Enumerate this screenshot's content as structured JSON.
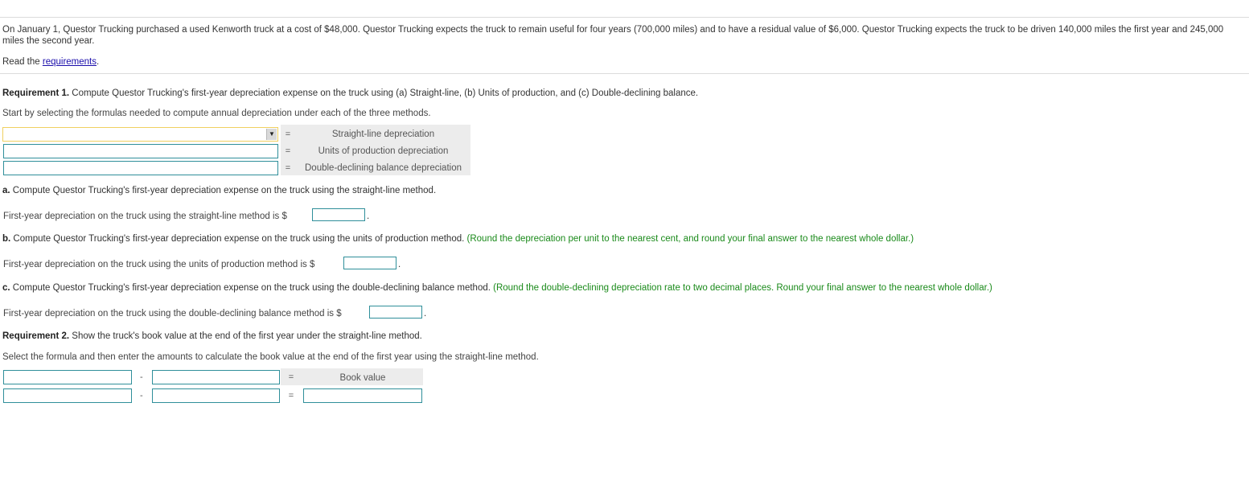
{
  "intro": {
    "text": "On January 1, Questor Trucking purchased a used Kenworth truck at a cost of $48,000. Questor Trucking expects the truck to remain useful for four years (700,000 miles) and to have a residual value of $6,000. Questor Trucking expects the truck to be driven 140,000 miles the first year and 245,000 miles the second year.",
    "read_prefix": "Read the ",
    "read_link": "requirements",
    "read_suffix": "."
  },
  "req1": {
    "bold": "Requirement 1.",
    "text": " Compute Questor Trucking's first-year depreciation expense on the truck using (a) Straight-line, (b) Units of production, and (c) Double-declining balance.",
    "instruction": "Start by selecting the formulas needed to compute annual depreciation under each of the three methods.",
    "formulas": [
      {
        "equals": "=",
        "label": "Straight-line depreciation"
      },
      {
        "equals": "=",
        "label": "Units of production depreciation"
      },
      {
        "equals": "=",
        "label": "Double-declining balance depreciation"
      }
    ]
  },
  "part_a": {
    "bold": "a.",
    "text": " Compute Questor Trucking's first-year depreciation expense on the truck using the straight-line method.",
    "answer_label": "First-year depreciation on the truck using the straight-line method is $",
    "period": "."
  },
  "part_b": {
    "bold": "b.",
    "text": " Compute Questor Trucking's first-year depreciation expense on the truck using the units of production method.",
    "note": " (Round the depreciation per unit to the nearest cent, and round your final answer to the nearest whole dollar.)",
    "answer_label": "First-year depreciation on the truck using the units of production method is $",
    "period": "."
  },
  "part_c": {
    "bold": "c.",
    "text": " Compute Questor Trucking's first-year depreciation expense on the truck using the double-declining balance method.",
    "note": " (Round the double-declining depreciation rate to two decimal places. Round your final answer to the nearest whole dollar.)",
    "answer_label": "First-year depreciation on the truck using the double-declining balance method is $",
    "period": "."
  },
  "req2": {
    "bold": "Requirement 2.",
    "text": " Show the truck's book value at the end of the first year under the straight-line method.",
    "instruction": "Select the formula and then enter the amounts to calculate the book value at the end of the first year using the straight-line method.",
    "minus": "-",
    "equals": "=",
    "result_label": "Book value"
  }
}
